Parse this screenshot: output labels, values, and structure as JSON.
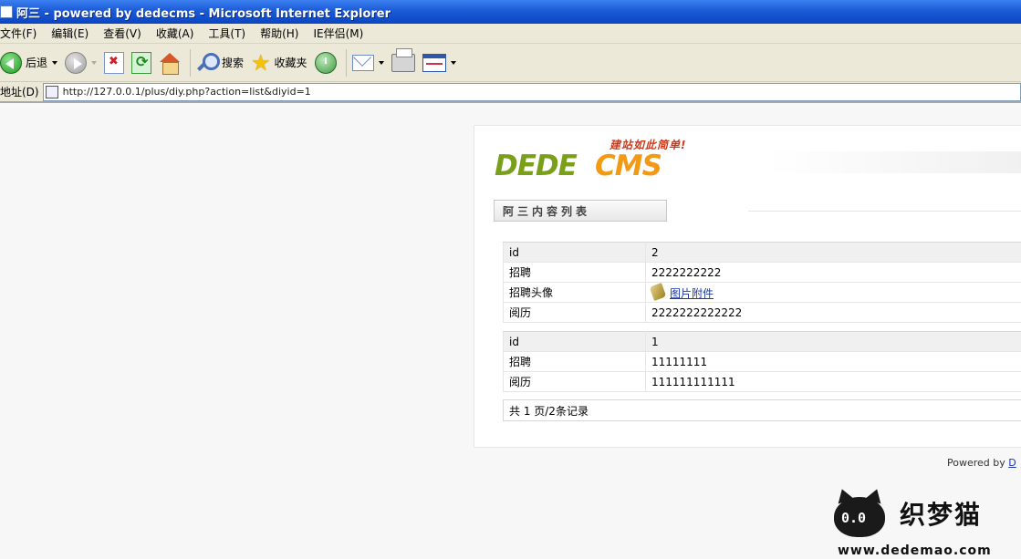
{
  "window": {
    "title": "阿三 - powered by dedecms - Microsoft Internet Explorer"
  },
  "menu": [
    "文件(F)",
    "编辑(E)",
    "查看(V)",
    "收藏(A)",
    "工具(T)",
    "帮助(H)",
    "IE伴侣(M)"
  ],
  "toolbar": {
    "back_label": "后退",
    "search_label": "搜索",
    "favorites_label": "收藏夹"
  },
  "address": {
    "label": "地址(D)",
    "url": "http://127.0.0.1/plus/diy.php?action=list&diyid=1"
  },
  "logo": {
    "slogan": "建站如此简单!",
    "part1": "DEDE",
    "part2": "CMS"
  },
  "list_title": "阿三内容列表",
  "records": [
    {
      "rows": [
        {
          "key": "id",
          "value": "2"
        },
        {
          "key": "招聘",
          "value": "2222222222"
        },
        {
          "key": "招聘头像",
          "value": "图片附件"
        },
        {
          "key": "阅历",
          "value": "2222222222222"
        }
      ]
    },
    {
      "rows": [
        {
          "key": "id",
          "value": "1"
        },
        {
          "key": "招聘",
          "value": "11111111"
        },
        {
          "key": "阅历",
          "value": "111111111111"
        }
      ]
    }
  ],
  "pager": "共 1 页/2条记录",
  "footer": {
    "powered_prefix": "Powered by",
    "powered_link": "D"
  },
  "watermark": {
    "cat_eyes": "0.0",
    "name": "织梦猫",
    "url": "www.dedemao.com"
  },
  "colors": {
    "titlebar": "#1b5bd6",
    "chrome": "#ece9d8",
    "link": "#1a38a8",
    "logo_green": "#7aa01a",
    "logo_orange": "#f39a15"
  }
}
